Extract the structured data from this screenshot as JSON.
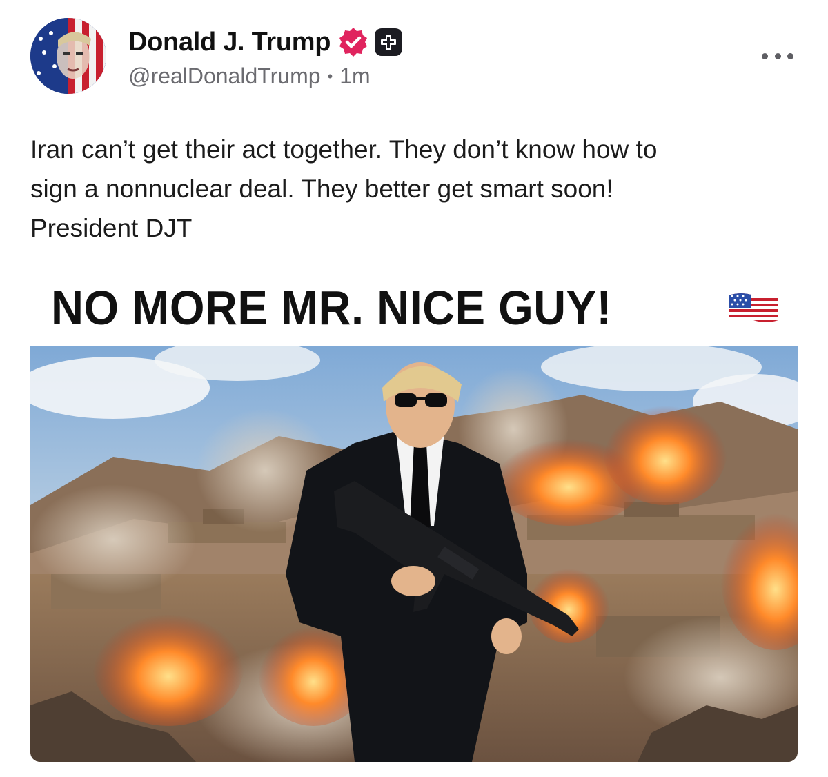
{
  "author": {
    "display_name": "Donald J. Trump",
    "handle": "@realDonaldTrump",
    "separator": "•",
    "timestamp": "1m"
  },
  "icons": {
    "avatar": "avatar-image",
    "verified": "verified-badge-icon",
    "plus": "plus-badge-icon",
    "more": "more-options-icon"
  },
  "colors": {
    "verified": "#e0245e",
    "plus_badge": "#1c1c22",
    "secondary_text": "#6b6b70"
  },
  "post": {
    "lines": [
      "Iran can’t get their act together. They don’t know how to",
      "sign a nonnuclear deal. They better get smart soon!",
      "President DJT"
    ]
  },
  "media": {
    "banner_text": "NO MORE MR. NICE GUY!",
    "banner_emoji": "us-flag-emoji"
  }
}
